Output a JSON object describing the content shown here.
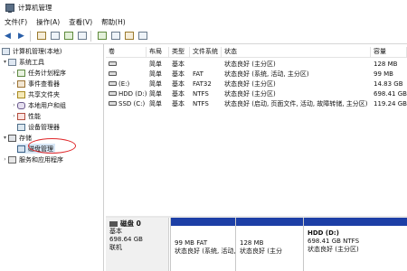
{
  "window": {
    "title": "计算机管理"
  },
  "menu": [
    "文件(F)",
    "操作(A)",
    "查看(V)",
    "帮助(H)"
  ],
  "tree": {
    "root": "计算机管理(本地)",
    "system_tools": "系统工具",
    "task_scheduler": "任务计划程序",
    "event_viewer": "事件查看器",
    "shared_folders": "共享文件夹",
    "local_users": "本地用户和组",
    "performance": "性能",
    "device_manager": "设备管理器",
    "storage": "存储",
    "disk_management": "磁盘管理",
    "services_apps": "服务和应用程序"
  },
  "volumes": {
    "headers": [
      "卷",
      "布局",
      "类型",
      "文件系统",
      "状态",
      "容量"
    ],
    "rows": [
      {
        "vol": "",
        "layout": "简单",
        "type": "基本",
        "fs": "",
        "status": "状态良好 (主分区)",
        "cap": "128 MB"
      },
      {
        "vol": "",
        "layout": "简单",
        "type": "基本",
        "fs": "FAT",
        "status": "状态良好 (系统, 活动, 主分区)",
        "cap": "99 MB"
      },
      {
        "vol": "(E:)",
        "layout": "简单",
        "type": "基本",
        "fs": "FAT32",
        "status": "状态良好 (主分区)",
        "cap": "14.83 GB"
      },
      {
        "vol": "HDD (D:)",
        "layout": "简单",
        "type": "基本",
        "fs": "NTFS",
        "status": "状态良好 (主分区)",
        "cap": "698.41 GB"
      },
      {
        "vol": "SSD (C:)",
        "layout": "简单",
        "type": "基本",
        "fs": "NTFS",
        "status": "状态良好 (启动, 页面文件, 活动, 故障转储, 主分区)",
        "cap": "119.24 GB"
      }
    ]
  },
  "disk0": {
    "name": "磁盘 0",
    "type": "基本",
    "size": "698.64 GB",
    "status": "联机",
    "partitions": [
      {
        "name": "",
        "size": "99 MB FAT",
        "status": "状态良好 (系统, 活动, 主"
      },
      {
        "name": "",
        "size": "128 MB",
        "status": "状态良好 (主分"
      },
      {
        "name": "HDD  (D:)",
        "size": "698.41 GB NTFS",
        "status": "状态良好 (主分区)"
      }
    ]
  },
  "colors": {
    "partition_bar": "#1d3fa6",
    "highlight_circle": "#e0282b"
  }
}
